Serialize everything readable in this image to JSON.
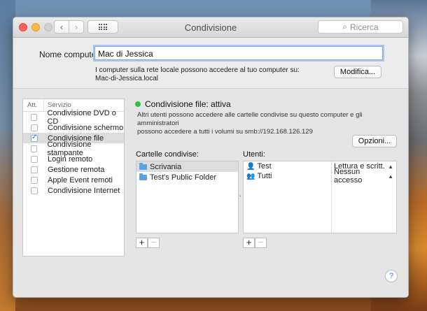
{
  "window": {
    "title": "Condivisione"
  },
  "toolbar": {
    "search_placeholder": "Ricerca"
  },
  "computer_name": {
    "label": "Nome computer:",
    "value": "Mac di Jessica",
    "help_line1": "I computer sulla rete locale possono accedere al tuo computer su:",
    "help_line2": "Mac-di-Jessica.local",
    "edit_button": "Modifica..."
  },
  "services": {
    "col_on": "Att.",
    "col_service": "Servizio",
    "items": [
      {
        "label": "Condivisione DVD o CD",
        "checked": false
      },
      {
        "label": "Condivisione schermo",
        "checked": false
      },
      {
        "label": "Condivisione file",
        "checked": true
      },
      {
        "label": "Condivisione stampante",
        "checked": false
      },
      {
        "label": "Login remoto",
        "checked": false
      },
      {
        "label": "Gestione remota",
        "checked": false
      },
      {
        "label": "Apple Event remoti",
        "checked": false
      },
      {
        "label": "Condivisione Internet",
        "checked": false
      }
    ]
  },
  "detail": {
    "status": "Condivisione file: attiva",
    "status_color": "#35c23c",
    "desc_line1": "Altri utenti possono accedere alle cartelle condivise su questo computer e gli amministratori",
    "desc_line2": "possono accedere a tutti i volumi su smb://192.168.126.129",
    "options_button": "Opzioni...",
    "shared_folders_label": "Cartelle condivise:",
    "users_label": "Utenti:",
    "folders": [
      {
        "name": "Scrivania"
      },
      {
        "name": "Test's Public Folder"
      }
    ],
    "users": [
      {
        "name": "Test",
        "permission": "Lettura e scritt."
      },
      {
        "name": "Tutti",
        "permission": "Nessun accesso"
      }
    ],
    "add_symbol": "+",
    "remove_symbol": "−"
  },
  "help_symbol": "?"
}
